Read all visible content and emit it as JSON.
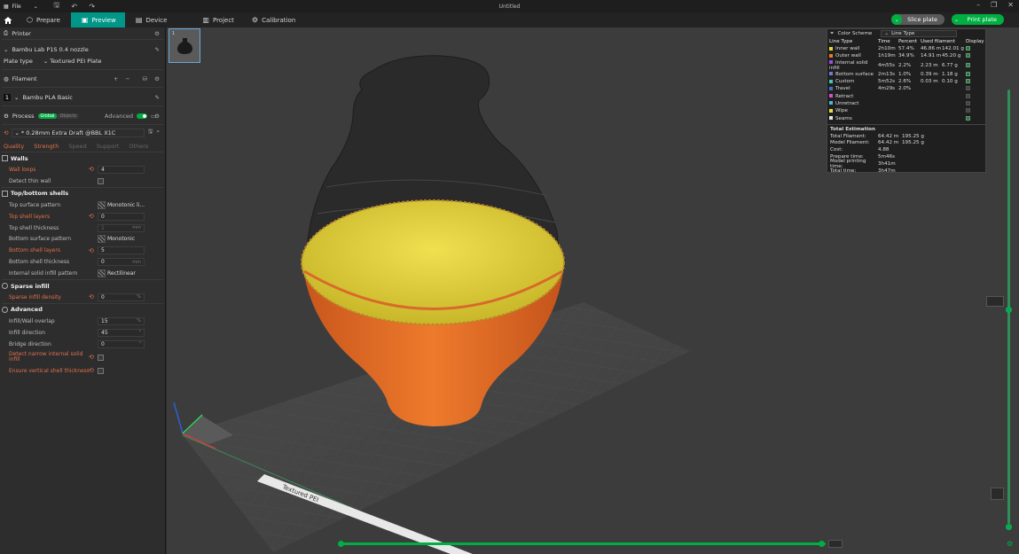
{
  "titlebar": {
    "file_label": "File",
    "title": "Untitled"
  },
  "nav": {
    "tabs": [
      {
        "label": "Prepare",
        "icon": "prepare-icon"
      },
      {
        "label": "Preview",
        "icon": "preview-icon"
      },
      {
        "label": "Device",
        "icon": "device-icon"
      },
      {
        "label": "Project",
        "icon": "project-icon"
      },
      {
        "label": "Calibration",
        "icon": "calibration-icon"
      }
    ],
    "active_tab": "Preview",
    "slice_label": "Slice plate",
    "print_label": "Print plate",
    "accent": "#00ae42",
    "active_tab_color": "#009688"
  },
  "printer": {
    "section_label": "Printer",
    "name": "Bambu Lab P1S 0.4 nozzle",
    "plate_type_label": "Plate type",
    "plate_type_value": "Textured PEI Plate"
  },
  "filament": {
    "section_label": "Filament",
    "slot": "1",
    "name": "Bambu PLA Basic"
  },
  "process": {
    "section_label": "Process",
    "global_label": "Global",
    "objects_label": "Objects",
    "advanced_label": "Advanced",
    "preset": "* 0.28mm Extra Draft @BBL X1C",
    "tabs": [
      "Quality",
      "Strength",
      "Speed",
      "Support",
      "Others"
    ],
    "active_tab": "Strength"
  },
  "settings": {
    "walls_title": "Walls",
    "wall_loops_label": "Wall loops",
    "wall_loops_value": "4",
    "detect_thin_wall_label": "Detect thin wall",
    "top_bottom_title": "Top/bottom shells",
    "top_surface_pattern_label": "Top surface pattern",
    "top_surface_pattern_value": "Monotonic li...",
    "top_shell_layers_label": "Top shell layers",
    "top_shell_layers_value": "0",
    "top_shell_thickness_label": "Top shell thickness",
    "top_shell_thickness_value": "1",
    "bottom_surface_pattern_label": "Bottom surface pattern",
    "bottom_surface_pattern_value": "Monotonic",
    "bottom_shell_layers_label": "Bottom shell layers",
    "bottom_shell_layers_value": "5",
    "bottom_shell_thickness_label": "Bottom shell thickness",
    "bottom_shell_thickness_value": "0",
    "internal_solid_infill_label": "Internal solid infill pattern",
    "internal_solid_infill_value": "Rectilinear",
    "sparse_title": "Sparse infill",
    "sparse_density_label": "Sparse infill density",
    "sparse_density_value": "0",
    "advanced_title": "Advanced",
    "infill_wall_overlap_label": "Infill/Wall overlap",
    "infill_wall_overlap_value": "15",
    "infill_direction_label": "Infill direction",
    "infill_direction_value": "45",
    "bridge_direction_label": "Bridge direction",
    "bridge_direction_value": "0",
    "detect_narrow_label_1": "Detect narrow internal solid",
    "detect_narrow_label_2": "infill",
    "ensure_vertical_label": "Ensure vertical shell thickness",
    "unit_mm": "mm",
    "unit_pct": "%",
    "unit_deg": "°"
  },
  "legend": {
    "title": "Color Scheme",
    "scheme": "Line Type",
    "headers": [
      "Line Type",
      "Time",
      "Percent",
      "Used filament",
      "Display"
    ],
    "rows": [
      {
        "name": "Inner wall",
        "time": "2h10m",
        "percent": "57.4%",
        "len": "46.86 m",
        "weight": "142.01 g",
        "color": "#e8d538",
        "on": true
      },
      {
        "name": "Outer wall",
        "time": "1h19m",
        "percent": "34.9%",
        "len": "14.91 m",
        "weight": "45.20 g",
        "color": "#e8782c",
        "on": true
      },
      {
        "name": "Internal solid infill",
        "time": "4m55s",
        "percent": "2.2%",
        "len": "2.23 m",
        "weight": "6.77 g",
        "color": "#9a4fd6",
        "on": true
      },
      {
        "name": "Bottom surface",
        "time": "2m13s",
        "percent": "1.0%",
        "len": "0.39 m",
        "weight": "1.18 g",
        "color": "#6f7bd4",
        "on": true
      },
      {
        "name": "Custom",
        "time": "5m52s",
        "percent": "2.6%",
        "len": "0.03 m",
        "weight": "0.10 g",
        "color": "#4fc2b1",
        "on": true
      },
      {
        "name": "Travel",
        "time": "4m29s",
        "percent": "2.0%",
        "len": "",
        "weight": "",
        "color": "#3f6fcc",
        "on": false
      },
      {
        "name": "Retract",
        "time": "",
        "percent": "",
        "len": "",
        "weight": "",
        "color": "#d24fc6",
        "on": false
      },
      {
        "name": "Unretract",
        "time": "",
        "percent": "",
        "len": "",
        "weight": "",
        "color": "#4ab6d6",
        "on": false
      },
      {
        "name": "Wipe",
        "time": "",
        "percent": "",
        "len": "",
        "weight": "",
        "color": "#e8e03a",
        "on": false
      },
      {
        "name": "Seams",
        "time": "",
        "percent": "",
        "len": "",
        "weight": "",
        "color": "#e6e6e6",
        "on": true
      }
    ],
    "total_title": "Total Estimation",
    "totals": [
      {
        "label": "Total Filament:",
        "a": "64.42 m",
        "b": "195.25 g"
      },
      {
        "label": "Model Filament:",
        "a": "64.42 m",
        "b": "195.25 g"
      },
      {
        "label": "Cost:",
        "a": "4.88",
        "b": ""
      },
      {
        "label": "Prepare time:",
        "a": "5m46s",
        "b": ""
      },
      {
        "label": "Model printing time:",
        "a": "3h41m",
        "b": ""
      },
      {
        "label": "Total time:",
        "a": "3h47m",
        "b": ""
      }
    ]
  },
  "viewport": {
    "thumb_number": "1",
    "bed_label": "Textured PEI"
  }
}
